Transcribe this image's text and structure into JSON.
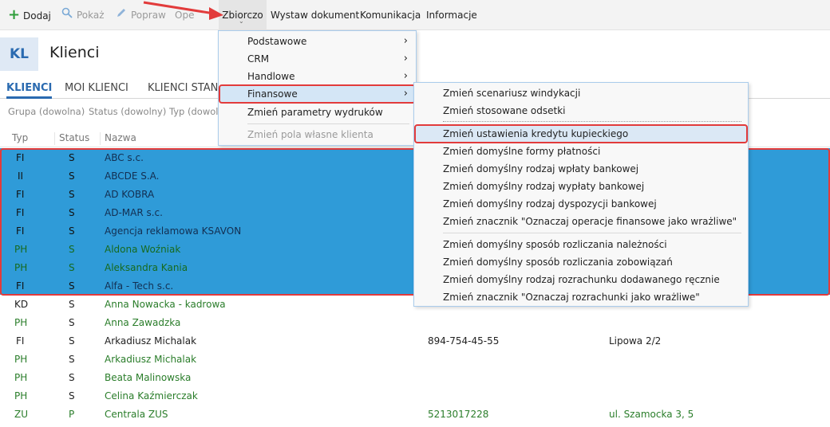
{
  "toolbar": {
    "dodaj": "Dodaj",
    "pokaz": "Pokaż",
    "popraw": "Popraw",
    "operacje": "Ope",
    "zbiorczo": "Zbiorczo",
    "wystaw": "Wystaw dokument",
    "komunikacja": "Komunikacja",
    "informacje": "Informacje"
  },
  "header": {
    "badge": "KL",
    "title": "Klienci"
  },
  "tabs": [
    "KLIENCI",
    "MOI KLIENCI",
    "KLIENCI STAND"
  ],
  "filters": [
    "Grupa (dowolna)",
    "Status (dowolny)",
    "Typ (dowoln"
  ],
  "columns": {
    "typ": "Typ",
    "status": "Status",
    "nazwa": "Nazwa"
  },
  "rows": [
    {
      "typ": "FI",
      "status": "S",
      "nazwa": "ABC s.c.",
      "nip": "",
      "adres": ""
    },
    {
      "typ": "II",
      "status": "S",
      "nazwa": "ABCDE S.A.",
      "nip": "",
      "adres": ""
    },
    {
      "typ": "FI",
      "status": "S",
      "nazwa": "AD KOBRA",
      "nip": "",
      "adres": ""
    },
    {
      "typ": "FI",
      "status": "S",
      "nazwa": "AD-MAR s.c.",
      "nip": "",
      "adres": ""
    },
    {
      "typ": "FI",
      "status": "S",
      "nazwa": "Agencja reklamowa KSAVON",
      "nip": "",
      "adres": ""
    },
    {
      "typ": "PH",
      "status": "S",
      "nazwa": "Aldona Woźniak",
      "nip": "",
      "adres": ""
    },
    {
      "typ": "PH",
      "status": "S",
      "nazwa": "Aleksandra Kania",
      "nip": "",
      "adres": ""
    },
    {
      "typ": "FI",
      "status": "S",
      "nazwa": "Alfa - Tech s.c.",
      "nip": "",
      "adres": ""
    },
    {
      "typ": "KD",
      "status": "S",
      "nazwa": "Anna Nowacka - kadrowa",
      "nip": "",
      "adres": ""
    },
    {
      "typ": "PH",
      "status": "S",
      "nazwa": "Anna Zawadzka",
      "nip": "",
      "adres": ""
    },
    {
      "typ": "FI",
      "status": "S",
      "nazwa": "Arkadiusz Michalak",
      "nip": "894-754-45-55",
      "adres": "Lipowa  2/2"
    },
    {
      "typ": "PH",
      "status": "S",
      "nazwa": "Arkadiusz Michalak",
      "nip": "",
      "adres": ""
    },
    {
      "typ": "PH",
      "status": "S",
      "nazwa": "Beata Malinowska",
      "nip": "",
      "adres": ""
    },
    {
      "typ": "PH",
      "status": "S",
      "nazwa": "Celina Kaźmierczak",
      "nip": "",
      "adres": ""
    },
    {
      "typ": "ZU",
      "status": "P",
      "nazwa": "Centrala ZUS",
      "nip": "5213017228",
      "adres": "ul. Szamocka 3, 5"
    }
  ],
  "menu1": [
    {
      "label": "Podstawowe",
      "sub": true
    },
    {
      "label": "CRM",
      "sub": true
    },
    {
      "label": "Handlowe",
      "sub": true
    },
    {
      "label": "Finansowe",
      "sub": true
    },
    {
      "label": "Zmień parametry wydruków",
      "sub": false
    },
    {
      "label": "Zmień pola własne klienta",
      "sub": false
    }
  ],
  "menu2": [
    "Zmień scenariusz windykacji",
    "Zmień stosowane odsetki",
    "Zmień ustawienia kredytu kupieckiego",
    "Zmień domyślne formy płatności",
    "Zmień domyślny rodzaj wpłaty bankowej",
    "Zmień domyślny rodzaj wypłaty bankowej",
    "Zmień domyślny rodzaj dyspozycji bankowej",
    "Zmień znacznik \"Oznaczaj operacje finansowe jako wrażliwe\"",
    "Zmień domyślny sposób rozliczania należności",
    "Zmień domyślny sposób rozliczania zobowiązań",
    "Zmień domyślny rodzaj rozrachunku dodawanego ręcznie",
    "Zmień znacznik \"Oznaczaj rozrachunki jako wrażliwe\""
  ],
  "colors": {
    "selection": "#2f9bd8",
    "highlight_border": "#e23b3b",
    "accent": "#2a6ab0"
  }
}
